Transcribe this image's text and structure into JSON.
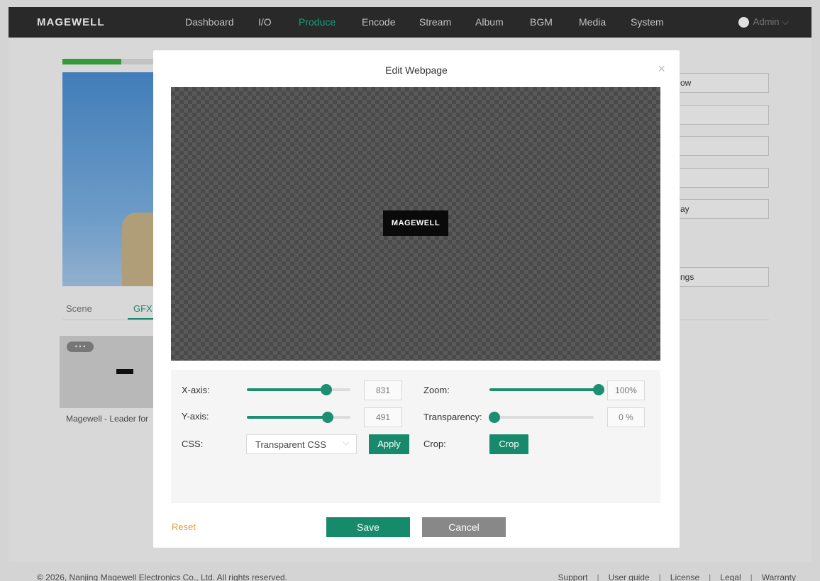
{
  "header": {
    "logo": "MAGEWELL",
    "nav": [
      "Dashboard",
      "I/O",
      "Produce",
      "Encode",
      "Stream",
      "Album",
      "BGM",
      "Media",
      "System"
    ],
    "active_nav": "Produce",
    "user": "Admin ⌵"
  },
  "background": {
    "tabs": [
      "Scene",
      "GFX"
    ],
    "active_tab": "GFX",
    "card_more": "• • •",
    "card_label": "Magewell - Leader for",
    "side_buttons": [
      "ow",
      "",
      "",
      "",
      "ay",
      "ngs"
    ],
    "audio_level": 0.65
  },
  "modal": {
    "title": "Edit Webpage",
    "close": "×",
    "canvas_logo": "MAGEWELL",
    "x_axis": {
      "label": "X-axis:",
      "value": "831",
      "fraction": 0.77
    },
    "y_axis": {
      "label": "Y-axis:",
      "value": "491",
      "fraction": 0.78
    },
    "zoom": {
      "label": "Zoom:",
      "value": "100%",
      "fraction": 1.0
    },
    "transparency": {
      "label": "Transparency:",
      "value": "0 %",
      "fraction": 0.0
    },
    "css": {
      "label": "CSS:",
      "selected": "Transparent CSS",
      "chevron": "⌵",
      "apply": "Apply"
    },
    "crop": {
      "label": "Crop:",
      "button": "Crop"
    },
    "reset": "Reset",
    "save": "Save",
    "cancel": "Cancel"
  },
  "footer": {
    "copyright": "© 2026, Nanjing Magewell Electronics Co., Ltd. All rights reserved.",
    "links": [
      "Support",
      "User guide",
      "License",
      "Legal",
      "Warranty"
    ],
    "separator": "|"
  },
  "colors": {
    "accent": "#178a6b",
    "nav_active": "#1bb38a",
    "reset": "#e8a13a"
  }
}
